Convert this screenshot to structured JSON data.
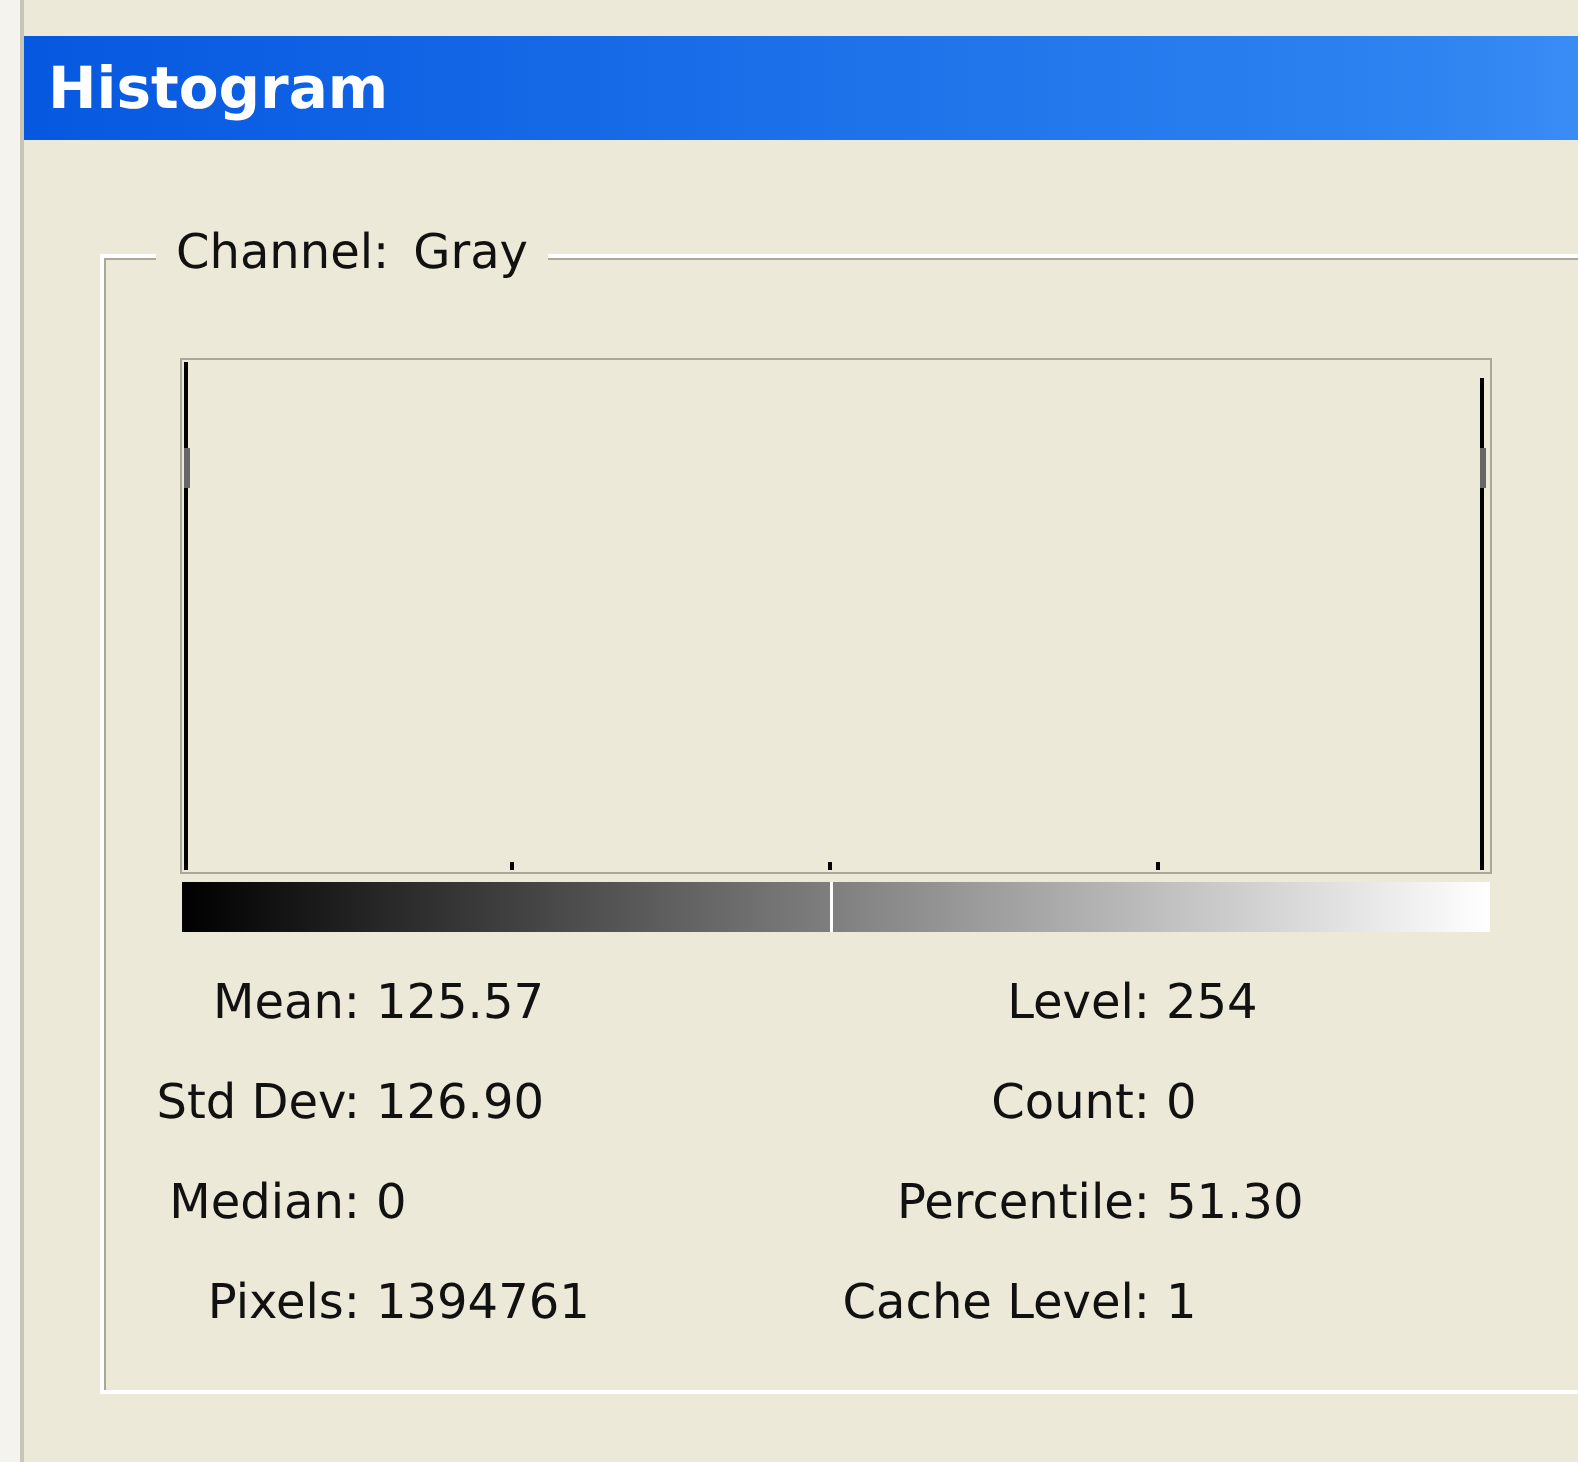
{
  "window": {
    "title": "Histogram"
  },
  "channel": {
    "label": "Channel:",
    "value": "Gray"
  },
  "stats_left": [
    {
      "label": "Mean:",
      "value": "125.57"
    },
    {
      "label": "Std Dev:",
      "value": "126.90"
    },
    {
      "label": "Median:",
      "value": "0"
    },
    {
      "label": "Pixels:",
      "value": "1394761"
    }
  ],
  "stats_right": [
    {
      "label": "Level:",
      "value": "254"
    },
    {
      "label": "Count:",
      "value": "0"
    },
    {
      "label": "Percentile:",
      "value": "51.30"
    },
    {
      "label": "Cache Level:",
      "value": "1"
    }
  ]
}
